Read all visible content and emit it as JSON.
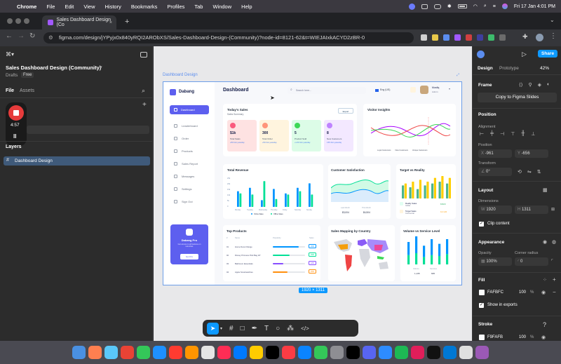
{
  "menubar": {
    "apple": "",
    "app": "Chrome",
    "items": [
      "File",
      "Edit",
      "View",
      "History",
      "Bookmarks",
      "Profiles",
      "Tab",
      "Window",
      "Help"
    ],
    "datetime": "Fri 17 Jan  4:01 PM"
  },
  "browser": {
    "tab_title": "Sales Dashboard Design (Co",
    "url": "figma.com/design/jYPyjx0x840yRQI2ARObXS/Sales-Dashboard-Design-(Community)?node-id=8121-62&t=WIEJAIxkACYD2zBR-0",
    "new_tab": "+",
    "close": "×"
  },
  "left_panel": {
    "file_title": "Sales Dashboard Design (Community)",
    "drafts": "Drafts",
    "plan": "Free",
    "tabs": [
      "File",
      "Assets"
    ],
    "recording_time": "4:57",
    "layers_header": "Layers",
    "layer": "Dashboard Design"
  },
  "canvas": {
    "frame_label": "Dashboard Design",
    "frame_size": "1920 × 1311"
  },
  "dashboard": {
    "logo": "Dabang",
    "title": "Dashboard",
    "search_placeholder": "Search here...",
    "language": "Eng (US)",
    "user_name": "Musfiq",
    "user_role": "Admin",
    "nav": [
      "Dashboard",
      "Leaderboard",
      "Order",
      "Products",
      "Sales Report",
      "Messages",
      "Settings",
      "Sign Out"
    ],
    "todays_sales": {
      "title": "Today's Sales",
      "subtitle": "Sales Summary",
      "export": "Export",
      "stats": [
        {
          "value": "$1k",
          "label": "Total Sales",
          "delta": "+8% from yesterday",
          "color": "#fee2e2",
          "icon_color": "#fa5a7d"
        },
        {
          "value": "300",
          "label": "Total Order",
          "delta": "+5% from yesterday",
          "color": "#fff4de",
          "icon_color": "#ff947a"
        },
        {
          "value": "5",
          "label": "Product Sold",
          "delta": "+1.2% from yesterday",
          "color": "#dcfce7",
          "icon_color": "#3cd856"
        },
        {
          "value": "8",
          "label": "New Customers",
          "delta": "0.5% from yesterday",
          "color": "#f3e8ff",
          "icon_color": "#bf83ff"
        }
      ]
    },
    "visitor_insights": {
      "title": "Visitor Insights",
      "legend": [
        "Loyal Customers",
        "New Customers",
        "Unique Customers"
      ]
    },
    "total_revenue": {
      "title": "Total Revenue",
      "days": [
        "Monday",
        "Tuesday",
        "Wednesday",
        "Thursday",
        "Friday",
        "Saturday",
        "Sunday"
      ],
      "legend": [
        "Online Sales",
        "Offline Sales"
      ],
      "ylabels": [
        "25k",
        "20k",
        "15k",
        "10k",
        "5k",
        "0"
      ]
    },
    "customer_satisfaction": {
      "title": "Customer Satisfaction",
      "legend": [
        "Last Month",
        "This Month"
      ],
      "values": [
        "$3,004",
        "$4,504"
      ]
    },
    "target_vs_reality": {
      "title": "Target vs Reality",
      "rows": [
        {
          "label": "Reality Sales",
          "sub": "Global",
          "value": "8.823"
        },
        {
          "label": "Target Sales",
          "sub": "Commercial",
          "value": "12.122"
        }
      ]
    },
    "top_products": {
      "title": "Top Products",
      "headers": [
        "#",
        "Name",
        "Popularity",
        "Sales"
      ],
      "rows": [
        {
          "n": "01",
          "name": "Home Decor Range",
          "pct": "45%"
        },
        {
          "n": "02",
          "name": "Disney Princess Pink Bag 18'",
          "pct": "29%"
        },
        {
          "n": "03",
          "name": "Bathroom Essentials",
          "pct": "18%"
        },
        {
          "n": "04",
          "name": "Apple Smartwatches",
          "pct": "25%"
        }
      ]
    },
    "sales_mapping": {
      "title": "Sales Mapping by Country"
    },
    "volume_service": {
      "title": "Volume vs Service Level",
      "legend": [
        "Volume",
        "Services"
      ],
      "values": [
        "1,135",
        "635"
      ]
    },
    "pro": {
      "title": "Dabang Pro",
      "text": "Get access to all features on tetumbas",
      "button": "Get Pro"
    }
  },
  "toolbar": {
    "tools": [
      "move",
      "frame",
      "rectangle",
      "pen",
      "text",
      "comment",
      "actions",
      "dev-mode"
    ]
  },
  "right_panel": {
    "tabs": [
      "Design",
      "Prototype"
    ],
    "zoom": "42%",
    "share": "Share",
    "frame": "Frame",
    "copy_slides": "Copy to Figma Slides",
    "position": "Position",
    "alignment": "Alignment",
    "pos_label": "Position",
    "x": "-961",
    "y": "-656",
    "transform": "Transform",
    "rotation": "0°",
    "layout": "Layout",
    "dimensions": "Dimensions",
    "w": "1920",
    "h": "1311",
    "clip": "Clip content",
    "appearance": "Appearance",
    "opacity_label": "Opacity",
    "corner_label": "Corner radius",
    "opacity": "100%",
    "corner": "0",
    "fill": "Fill",
    "fill_hex": "FAFBFC",
    "fill_pct": "100",
    "fill_unit": "%",
    "show_exports": "Show in exports",
    "stroke": "Stroke",
    "stroke_hex": "F9FAFB",
    "stroke_pct": "100",
    "stroke_unit": "%",
    "help": "?"
  },
  "dock": {
    "colors": [
      "#4a90e2",
      "#ff7f50",
      "#5ac8fa",
      "#ea4335",
      "#34c759",
      "#1e90ff",
      "#ff3b30",
      "#ff9500",
      "#e5e5e5",
      "#ff2d55",
      "#007aff",
      "#ffcc00",
      "#000000",
      "#fc3c44",
      "#0a84ff",
      "#34c759",
      "#8e8e93",
      "#000000",
      "#5865f2",
      "#2d8cff",
      "#1db954",
      "#e01e5a",
      "#111111",
      "#0078d4",
      "#e0e0e0",
      "#9b59b6"
    ]
  }
}
